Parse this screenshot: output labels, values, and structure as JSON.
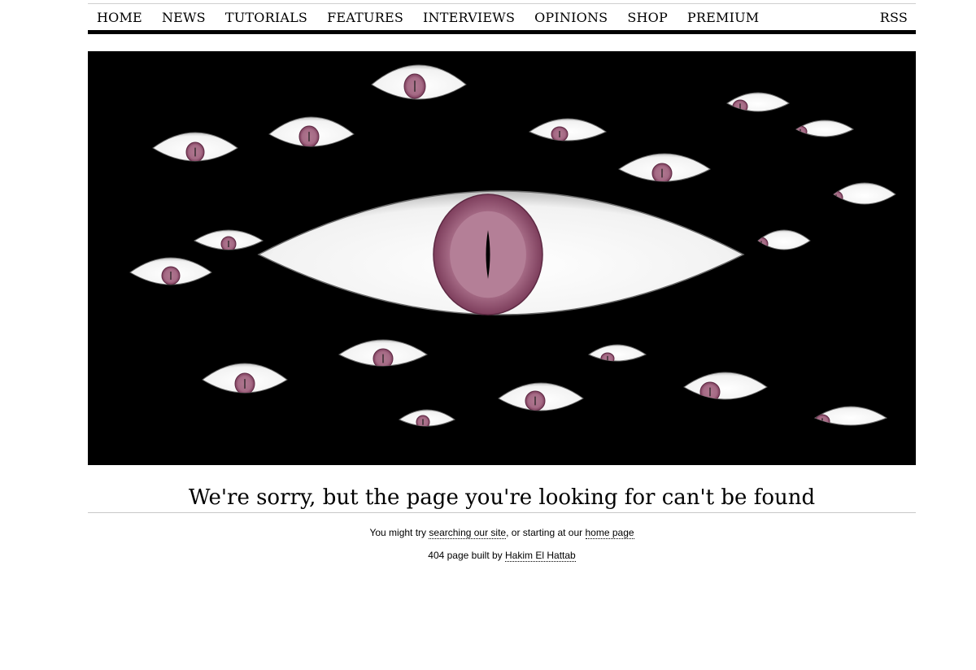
{
  "nav": {
    "items": [
      "HOME",
      "NEWS",
      "TUTORIALS",
      "FEATURES",
      "INTERVIEWS",
      "OPINIONS",
      "SHOP",
      "PREMIUM"
    ],
    "rss": "RSS"
  },
  "heading": "We're sorry, but the page you're looking for can't be found",
  "suggestion": {
    "prefix": "You might try ",
    "search_link": "searching our site",
    "middle": ", or starting at our ",
    "home_link": "home page"
  },
  "credit": {
    "prefix": "404 page built by ",
    "author_link": "Hakim El Hattab"
  },
  "colors": {
    "hero_bg": "#000000",
    "iris": "#b07890",
    "iris_ring": "#8a4a68",
    "eye_white": "#ffffff"
  },
  "icons": [
    "eyes-illustration"
  ]
}
